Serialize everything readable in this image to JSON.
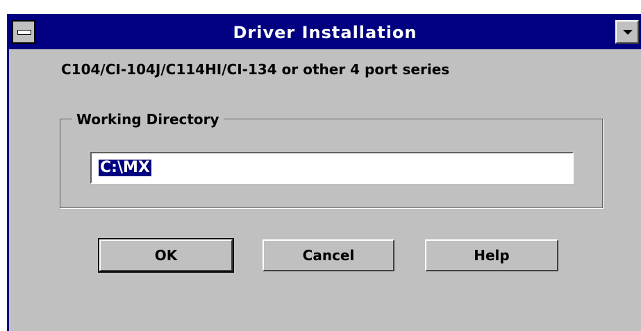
{
  "window": {
    "title": "Driver Installation"
  },
  "message": "C104/CI-104J/C114HI/CI-134 or other 4 port series",
  "working_directory": {
    "group_label": "Working Directory",
    "value": "C:\\MX"
  },
  "buttons": {
    "ok": "OK",
    "cancel": "Cancel",
    "help": "Help"
  },
  "icons": {
    "system_menu": "system-menu-icon",
    "dropdown": "triangle-down-icon"
  },
  "colors": {
    "titlebar": "#000080",
    "face": "#c0c0c0",
    "selection": "#000080"
  }
}
